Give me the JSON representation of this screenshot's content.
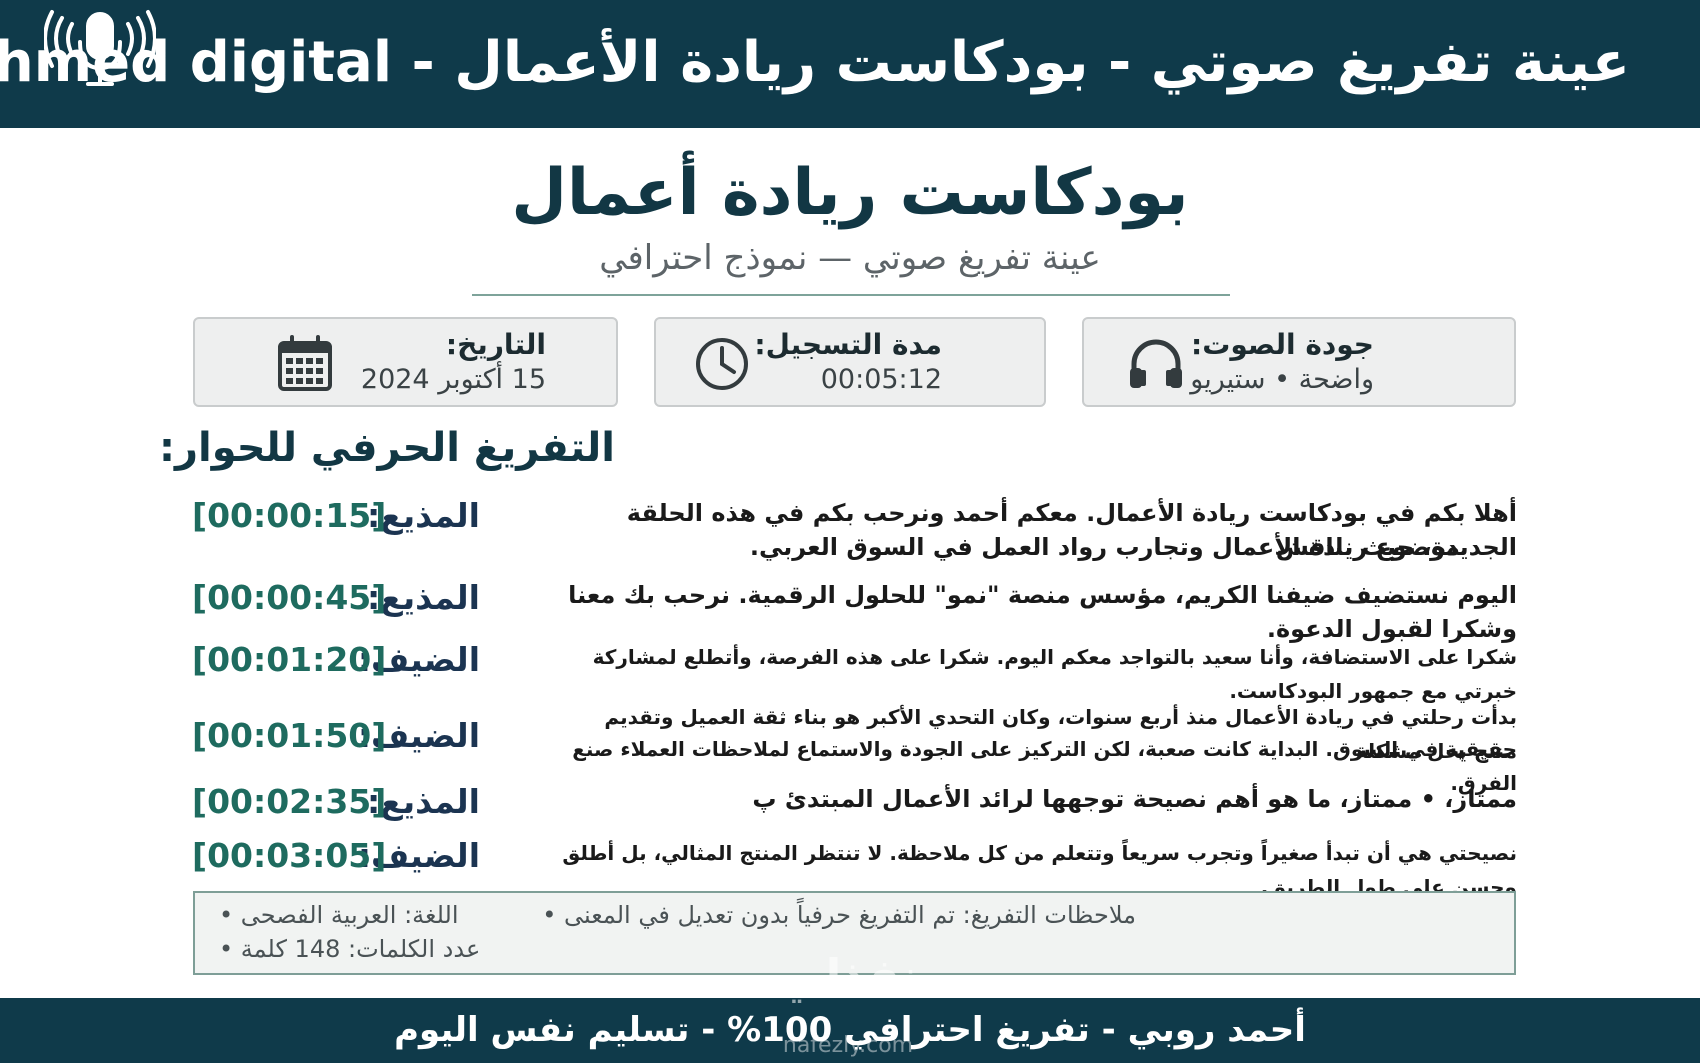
{
  "header": {
    "title": "عينة تفريغ صوتي - بودكاست ريادة الأعمال - Ahmed digital",
    "mic_icon": "microphone-broadcast-icon"
  },
  "document": {
    "title": "بودكاست ريادة أعمال",
    "subtitle": "عينة تفريغ صوتي — نموذج احترافي"
  },
  "info": {
    "quality": {
      "label": "جودة الصوت:",
      "value": "واضحة • ستيريو",
      "icon": "headphones-icon"
    },
    "duration": {
      "label": "مدة التسجيل:",
      "value": "00:05:12",
      "icon": "clock-icon"
    },
    "date": {
      "label": "التاريخ:",
      "value": "15 أكتوبر 2024",
      "icon": "calendar-icon"
    }
  },
  "transcript": {
    "heading": "التفريغ الحرفي للحوار:",
    "rows": [
      {
        "speaker": "المذيع:",
        "time": "[00:00:15]",
        "line1": "أهلا بكم في بودكاست ريادة الأعمال. معكم أحمد ونرحب بكم في هذه الحلقة الجديدة، حيث نناقش",
        "line2": "موضوع ريادة الأعمال وتجارب رواد العمل في السوق العربي."
      },
      {
        "speaker": "المذيع:",
        "time": "[00:00:45]",
        "line1": "اليوم نستضيف ضيفنا الكريم، مؤسس منصة \"نمو\" للحلول الرقمية. نرحب بك معنا وشكرا لقبول الدعوة."
      },
      {
        "speaker": "الضيف:",
        "time": "[00:01:20]",
        "line1": "شكرا على الاستضافة، وأنا سعيد بالتواجد معكم اليوم. شكرا على هذه الفرصة، وأتطلع لمشاركة خبرتي مع جمهور البودكاست."
      },
      {
        "speaker": "الضيف:",
        "time": "[00:01:50]",
        "line1": "بدأت رحلتي في ريادة الأعمال منذ أربع سنوات، وكان التحدي الأكبر هو بناء ثقة العميل وتقديم منتج يحل مشكلة",
        "line2": "حقيقية في السوق. البداية كانت صعبة، لكن التركيز على الجودة والاستماع لملاحظات العملاء صنع الفرق."
      },
      {
        "speaker": "المذيع:",
        "time": "[00:02:35]",
        "line1": "ممتاز، • ممتاز، ما هو أهم نصيحة توجهها لرائد الأعمال المبتدئ پ"
      },
      {
        "speaker": "الضيف:",
        "time": "[00:03:05]",
        "line1": "نصيحتي هي أن تبدأ صغيراً وتجرب سريعاً وتتعلم من كل ملاحظة. لا تنتظر المنتج المثالي، بل أطلق وحسن على طول الطريق."
      }
    ]
  },
  "notes": {
    "transcription": "ملاحظات التفريغ: تم التفريغ حرفياً بدون تعديل في المعنى",
    "language": "اللغة: العربية الفصحى",
    "word_count": "عدد الكلمات: 148 كلمة"
  },
  "footer": {
    "text": "أحمد روبي - تفريغ احترافي 100% - تسليم نفس اليوم"
  },
  "watermark": {
    "brand": "نفذلي",
    "url": "nafezly.com"
  },
  "colors": {
    "header_bg": "#0f3a4a",
    "title": "#123744",
    "speaker": "#1b3451",
    "timestamp": "#1e6b5f",
    "rule": "#7ea39a"
  }
}
